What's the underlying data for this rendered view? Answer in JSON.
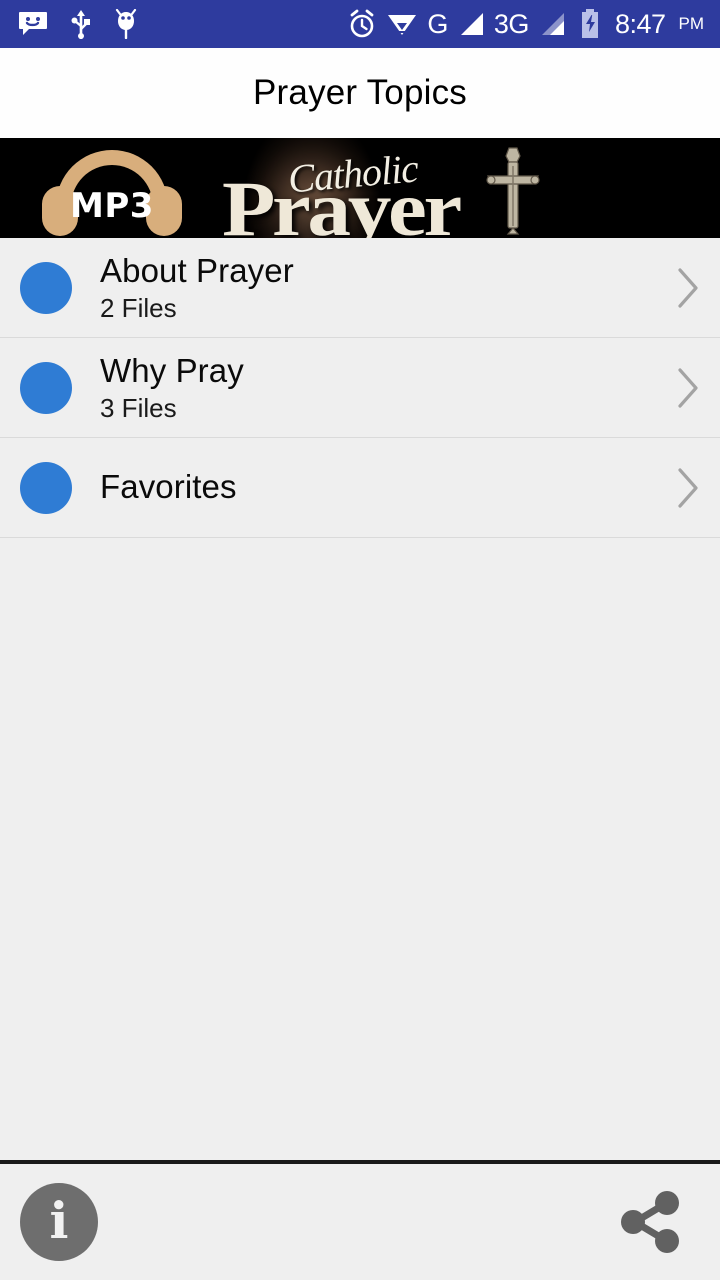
{
  "status_bar": {
    "background_color": "#2e3b9e",
    "icons": [
      {
        "name": "messaging-icon",
        "label": "Messaging"
      },
      {
        "name": "usb-icon",
        "label": "USB connected"
      },
      {
        "name": "android-debug-icon",
        "label": "USB debugging"
      },
      {
        "name": "alarm-icon",
        "label": "Alarm set"
      },
      {
        "name": "wifi-icon",
        "label": "Wi-Fi"
      },
      {
        "name": "signal-g-icon",
        "label": "G"
      },
      {
        "name": "signal-3g-icon",
        "label": "3G"
      },
      {
        "name": "battery-charging-icon",
        "label": "Battery charging"
      }
    ],
    "network_g_label": "G",
    "network_3g_label": "3G",
    "time": "8:47",
    "time_period": "PM"
  },
  "app_bar": {
    "title": "Prayer Topics",
    "background_color": "#fefefe",
    "text_color": "#000000"
  },
  "banner": {
    "name": "catholic-prayer-banner",
    "badge_text": "MP3",
    "word_top": "Catholic",
    "word_main": "Prayer",
    "background_color": "#000000",
    "accent_color": "#d8ae7c"
  },
  "list": {
    "accent_color": "#2f7cd4",
    "items": [
      {
        "title": "About Prayer",
        "subtitle": "2 Files"
      },
      {
        "title": "Why Pray",
        "subtitle": "3 Files"
      },
      {
        "title": "Favorites",
        "subtitle": ""
      }
    ]
  },
  "bottom_bar": {
    "info_label": "i",
    "info_name": "info-button",
    "share_name": "share-button",
    "background_color": "#efefef",
    "icon_color": "#6e6e6e"
  }
}
